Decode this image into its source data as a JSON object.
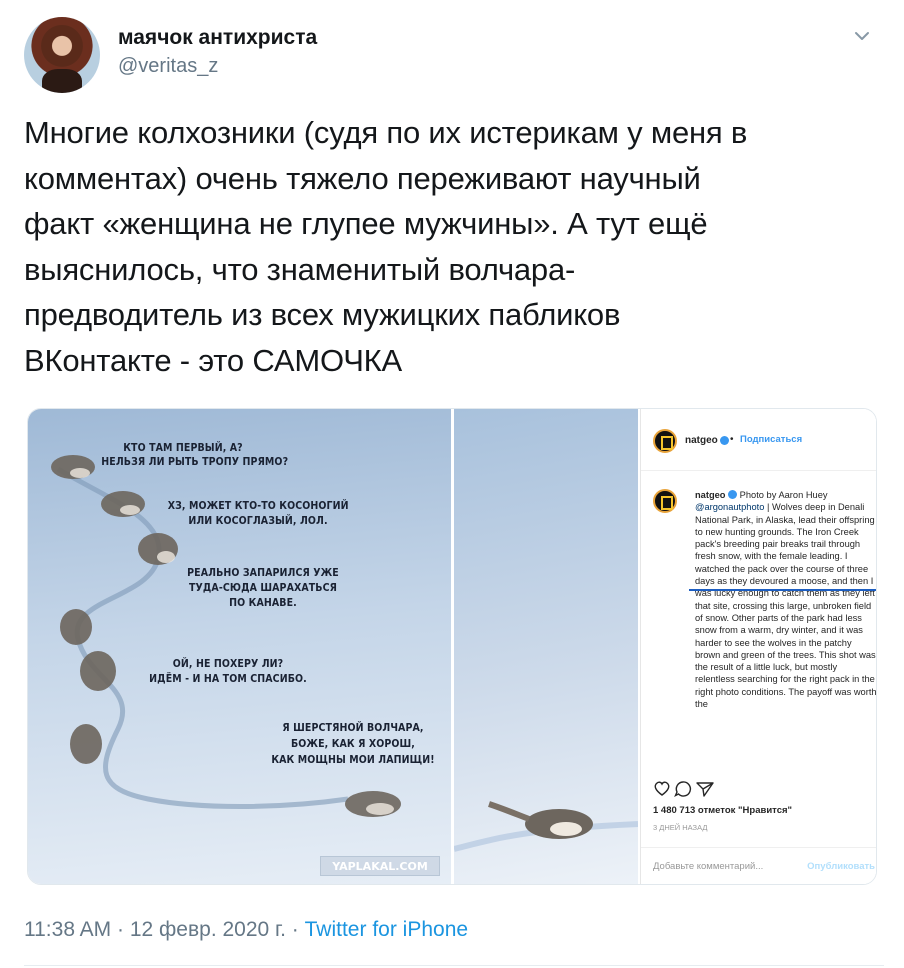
{
  "tweet": {
    "author": {
      "name": "маячок антихриста",
      "handle": "@veritas_z"
    },
    "menu_icon": "chevron-down-icon",
    "text_lines": [
      "Многие колхозники (судя по их истерикам у меня в",
      "комментах)  очень тяжело переживают научный",
      "факт «женщина не глупее мужчины». А тут ещё",
      "выяснилось, что знаменитый волчара-",
      "предводитель из всех мужицких пабликов",
      "ВКонтакте - это САМОЧКА"
    ],
    "timestamp": "11:38 AM · 12 февр. 2020 г. · ",
    "source": "Twitter for iPhone",
    "colors": {
      "text": "#14171a",
      "secondary": "#657786",
      "link": "#1b95e0"
    }
  },
  "meme": {
    "captions": [
      [
        "КТО ТАМ ПЕРВЫЙ, А?",
        "НЕЛЬЗЯ ЛИ РЫТЬ ТРОПУ ПРЯМО?"
      ],
      [
        "ХЗ, МОЖЕТ КТО-ТО КОСОНОГИЙ",
        "ИЛИ КОСОГЛАЗЫЙ, ЛОЛ."
      ],
      [
        "РЕАЛЬНО ЗАПАРИЛСЯ УЖЕ",
        "ТУДА-СЮДА ШАРАХАТЬСЯ",
        "ПО КАНАВЕ."
      ],
      [
        "ОЙ, НЕ ПОХЕРУ ЛИ?",
        "ИДЁМ - И НА ТОМ СПАСИБО."
      ],
      [
        "Я ШЕРСТЯНОЙ ВОЛЧАРА,",
        "БОЖЕ, КАК Я ХОРОШ,",
        "КАК МОЩНЫ МОИ ЛАПИЩИ!"
      ]
    ],
    "watermark": "YAPLAKAL.COM"
  },
  "instagram": {
    "account": "natgeo",
    "follow_label": "Подписаться",
    "separator": "•",
    "caption_name": "natgeo",
    "caption_prefix": "Photo by Aaron Huey ",
    "caption_mention": "@argonautphoto",
    "caption_body": " | Wolves deep in Denali National Park, in Alaska, lead their offspring to new hunting grounds. The Iron Creek pack's breeding pair breaks trail through fresh snow, with the female leading. I watched the pack over the course of three days as they devoured a moose, and then I was lucky enough to catch them as they left that site, crossing this large, unbroken field of snow. Other parts of the park had less snow from a warm, dry winter, and it was harder to see the wolves in the patchy brown and green of the trees. This shot was the result of a little luck, but mostly relentless searching for the right pack in the right photo conditions. The payoff was worth the",
    "likes": "1 480 713 отметок \"Нравится\"",
    "posted_ago": "3 ДНЕЙ НАЗАД",
    "comment_placeholder": "Добавьте комментарий...",
    "comment_post": "Опубликовать"
  }
}
